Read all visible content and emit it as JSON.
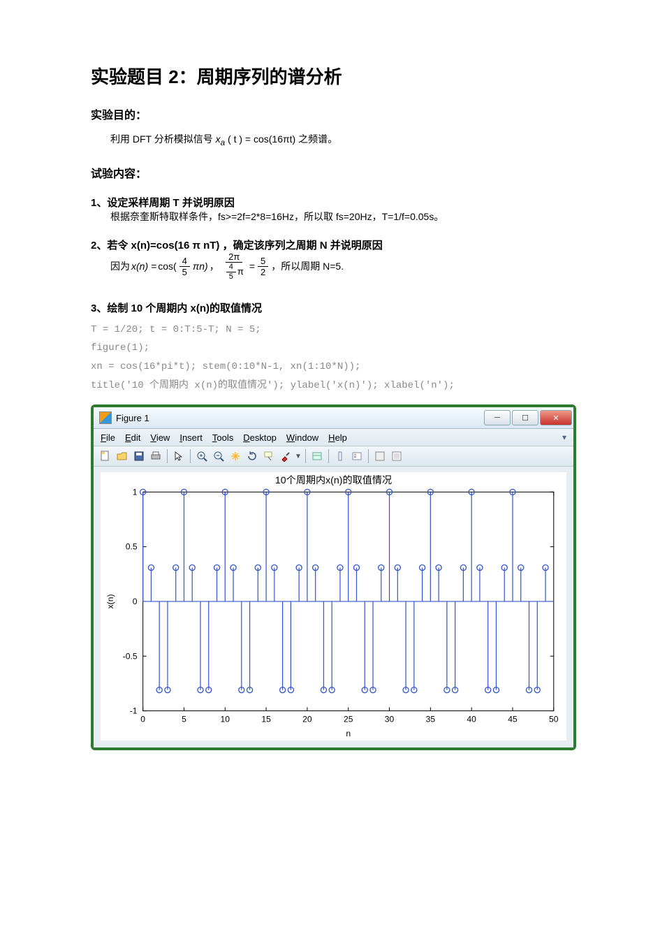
{
  "title": "实验题目 2：周期序列的谱分析",
  "sections": {
    "purpose_h": "实验目的：",
    "purpose_pre": "利用 DFT 分析模拟信号 ",
    "purpose_eq_lhs": "x",
    "purpose_eq_sub": "a",
    "purpose_eq_arg": "( t )",
    "purpose_eq_eq": " = ",
    "purpose_eq_rhs": "cos(16πt)",
    "purpose_post": " 之频谱。",
    "content_h": "试验内容：",
    "s1_head": "1、设定采样周期 T 并说明原因",
    "s1_body": "根据奈奎斯特取样条件，fs>=2f=2*8=16Hz，所以取 fs=20Hz，T=1/f=0.05s。",
    "s2_head": "2、若令 x(n)=cos(16 π nT) ，确定该序列之周期 N 并说明原因",
    "s2_pre": "因为 ",
    "s2_xn": "x(n) = ",
    "s2_cos": "cos(",
    "s2_frac1_num": "4",
    "s2_frac1_den": "5",
    "s2_pi_n": "πn)",
    "s2_comma1": " ，",
    "s2_frac2_num": "2π",
    "s2_frac2_den_num": "4",
    "s2_frac2_den_den": "5",
    "s2_frac2_den_pi": "π",
    "s2_eq": " = ",
    "s2_frac3_num": "5",
    "s2_frac3_den": "2",
    "s2_post": " ，所以周期 N=5.",
    "s3_head": "3、绘制 10 个周期内 x(n)的取值情况",
    "code": "T = 1/20; t = 0:T:5-T; N = 5;\nfigure(1);\nxn = cos(16*pi*t); stem(0:10*N-1, xn(1:10*N));\ntitle('10 个周期内 x(n)的取值情况'); ylabel('x(n)'); xlabel('n');"
  },
  "figure": {
    "win_title": "Figure 1",
    "menu": [
      "File",
      "Edit",
      "View",
      "Insert",
      "Tools",
      "Desktop",
      "Window",
      "Help"
    ],
    "menu_accel": [
      "F",
      "E",
      "V",
      "I",
      "T",
      "D",
      "W",
      "H"
    ]
  },
  "chart_data": {
    "type": "stem",
    "title": "10个周期内x(n)的取值情况",
    "xlabel": "n",
    "ylabel": "x(n)",
    "xlim": [
      0,
      50
    ],
    "ylim": [
      -1,
      1
    ],
    "xticks": [
      0,
      5,
      10,
      15,
      20,
      25,
      30,
      35,
      40,
      45,
      50
    ],
    "yticks": [
      -1,
      -0.5,
      0,
      0.5,
      1
    ],
    "x": [
      0,
      1,
      2,
      3,
      4,
      5,
      6,
      7,
      8,
      9,
      10,
      11,
      12,
      13,
      14,
      15,
      16,
      17,
      18,
      19,
      20,
      21,
      22,
      23,
      24,
      25,
      26,
      27,
      28,
      29,
      30,
      31,
      32,
      33,
      34,
      35,
      36,
      37,
      38,
      39,
      40,
      41,
      42,
      43,
      44,
      45,
      46,
      47,
      48,
      49
    ],
    "y": [
      1,
      0.309,
      -0.809,
      -0.809,
      0.309,
      1,
      0.309,
      -0.809,
      -0.809,
      0.309,
      1,
      0.309,
      -0.809,
      -0.809,
      0.309,
      1,
      0.309,
      -0.809,
      -0.809,
      0.309,
      1,
      0.309,
      -0.809,
      -0.809,
      0.309,
      1,
      0.309,
      -0.809,
      -0.809,
      0.309,
      1,
      0.309,
      -0.809,
      -0.809,
      0.309,
      1,
      0.309,
      -0.809,
      -0.809,
      0.309,
      1,
      0.309,
      -0.809,
      -0.809,
      0.309,
      1,
      0.309,
      -0.809,
      -0.809,
      0.309
    ]
  }
}
